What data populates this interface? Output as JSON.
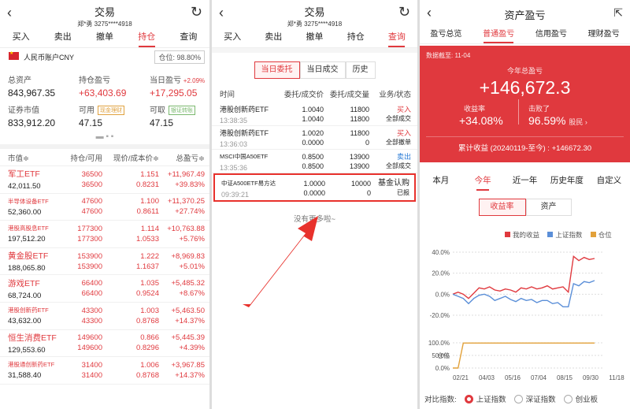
{
  "left": {
    "title": "交易",
    "subtitle": "郑*勇 3275****4918",
    "tabs": [
      "买入",
      "卖出",
      "撤单",
      "持仓",
      "查询"
    ],
    "account_label": "人民币账户CNY",
    "position_ratio": "仓位: 98.80%",
    "total_assets_label": "总资产",
    "total_assets": "843,967.35",
    "holding_pl_label": "持仓盈亏",
    "holding_pl": "+63,403.69",
    "day_pl_label": "当日盈亏",
    "day_pl_pct": "+2.09%",
    "day_pl": "+17,295.05",
    "mv_label": "证券市值",
    "mv": "833,912.20",
    "avail_label": "可用",
    "avail_tag": "现金理财",
    "avail": "47.15",
    "withdraw_label": "可取",
    "withdraw_tag": "银证转账",
    "withdraw": "47.15",
    "dots": "▬ ▪ ▪",
    "cols": [
      "市值≑",
      "持仓/可用",
      "现价/成本价≑",
      "总盈亏≑"
    ],
    "rows": [
      {
        "name": "军工ETF",
        "mv": "42,011.50",
        "h": "36500",
        "a": "36500",
        "p": "1.151",
        "c": "0.8231",
        "pl": "+11,967.49",
        "pct": "+39.83%",
        "small": false
      },
      {
        "name": "半导体设备ETF",
        "mv": "52,360.00",
        "h": "47600",
        "a": "47600",
        "p": "1.100",
        "c": "0.8611",
        "pl": "+11,370.25",
        "pct": "+27.74%",
        "small": true
      },
      {
        "name": "港股高股息ETF",
        "mv": "197,512.20",
        "h": "177300",
        "a": "177300",
        "p": "1.114",
        "c": "1.0533",
        "pl": "+10,763.88",
        "pct": "+5.76%",
        "small": true
      },
      {
        "name": "黄金股ETF",
        "mv": "188,065.80",
        "h": "153900",
        "a": "153900",
        "p": "1.222",
        "c": "1.1637",
        "pl": "+8,969.83",
        "pct": "+5.01%",
        "small": false
      },
      {
        "name": "游戏ETF",
        "mv": "68,724.00",
        "h": "66400",
        "a": "66400",
        "p": "1.035",
        "c": "0.9524",
        "pl": "+5,485.32",
        "pct": "+8.67%",
        "small": false
      },
      {
        "name": "港股创新药ETF",
        "mv": "43,632.00",
        "h": "43300",
        "a": "43300",
        "p": "1.003",
        "c": "0.8768",
        "pl": "+5,463.50",
        "pct": "+14.37%",
        "small": true
      },
      {
        "name": "恒生消费ETF",
        "mv": "129,553.60",
        "h": "149600",
        "a": "149600",
        "p": "0.866",
        "c": "0.8296",
        "pl": "+5,445.39",
        "pct": "+4.39%",
        "small": false
      },
      {
        "name": "港股通创新药ETF",
        "mv": "31,588.40",
        "h": "31400",
        "a": "31400",
        "p": "1.006",
        "c": "0.8768",
        "pl": "+3,967.85",
        "pct": "+14.37%",
        "small": true
      }
    ]
  },
  "middle": {
    "title": "交易",
    "subtitle": "郑*勇 3275****4918",
    "tabs": [
      "买入",
      "卖出",
      "撤单",
      "持仓",
      "查询"
    ],
    "subtabs": [
      "当日委托",
      "当日成交",
      "历史"
    ],
    "cols": [
      "时间",
      "委托/成交价",
      "委托/成交量",
      "业务/状态"
    ],
    "orders": [
      {
        "name": "港股创新药ETF",
        "time": "13:38:35",
        "p1": "1.0040",
        "p2": "1.0040",
        "q1": "11800",
        "q2": "11800",
        "side": "买入",
        "status": "全部成交",
        "color": "red"
      },
      {
        "name": "港股创新药ETF",
        "time": "13:36:03",
        "p1": "1.0020",
        "p2": "0.0000",
        "q1": "11800",
        "q2": "0",
        "side": "买入",
        "status": "全部撤单",
        "color": "red"
      },
      {
        "name": "MSCI中国A50ETF",
        "time": "13:35:36",
        "p1": "0.8500",
        "p2": "0.8500",
        "q1": "13900",
        "q2": "13900",
        "side": "卖出",
        "status": "全部成交",
        "color": "blue"
      },
      {
        "name": "中证A500ETF易方达",
        "time": "09:39:21",
        "p1": "1.0000",
        "p2": "0.0000",
        "q1": "10000",
        "q2": "0",
        "side": "基金认购",
        "status": "已报",
        "color": "dark"
      }
    ],
    "more": "没有更多啦~"
  },
  "right": {
    "title": "资产盈亏",
    "tabs": [
      "盈亏总览",
      "普通盈亏",
      "信用盈亏",
      "理财盈亏"
    ],
    "date": "数据截至: 11-04",
    "year_label": "今年总盈亏",
    "year_pl": "+146,672.3",
    "return_label": "收益率",
    "return": "+34.08%",
    "beat_label": "击败了",
    "beat": "96.59%",
    "beat_suffix": "股民 ›",
    "cum": "累计收益 (20240119-至今) : +146672.30",
    "periods": [
      "本月",
      "今年",
      "近一年",
      "历史年度",
      "自定义"
    ],
    "mtabs": [
      "收益率",
      "资产"
    ],
    "legend": [
      "我的收益",
      "上证指数",
      "仓位"
    ],
    "compare_label": "对比指数:",
    "compare": [
      "上证指数",
      "深证指数",
      "创业板"
    ]
  },
  "chart_data": {
    "type": "line",
    "x_ticks": [
      "02/21",
      "04/03",
      "05/16",
      "07/04",
      "08/15",
      "09/30",
      "11/18"
    ],
    "y_ticks": [
      "40.0%",
      "20.0%",
      "0.0%",
      "-20.0%"
    ],
    "ylim": [
      -20,
      40
    ],
    "series": [
      {
        "name": "我的收益",
        "color": "#e0393e",
        "values": [
          0,
          2,
          0,
          -4,
          1,
          6,
          5,
          7,
          4,
          3,
          5,
          4,
          2,
          6,
          5,
          7,
          5,
          6,
          8,
          5,
          6,
          7,
          2,
          36,
          32,
          35,
          33,
          34
        ]
      },
      {
        "name": "上证指数",
        "color": "#5b8fd8",
        "values": [
          0,
          -2,
          -4,
          -9,
          -4,
          -1,
          0,
          -2,
          -6,
          -4,
          -2,
          -5,
          -7,
          -4,
          -6,
          -5,
          -8,
          -6,
          -6,
          -9,
          -8,
          -12,
          -12,
          10,
          8,
          12,
          11,
          13
        ]
      }
    ],
    "position": {
      "name": "仓位",
      "color": "#e2a13a",
      "y_ticks": [
        "100.0%",
        "50.0%",
        "0.0%"
      ],
      "values": [
        0,
        0,
        99,
        99,
        99,
        99,
        99,
        99,
        99,
        99,
        99,
        99,
        99,
        99,
        99,
        99,
        99,
        99,
        99,
        99,
        99,
        99,
        99,
        99,
        99,
        99,
        99,
        99
      ]
    }
  }
}
